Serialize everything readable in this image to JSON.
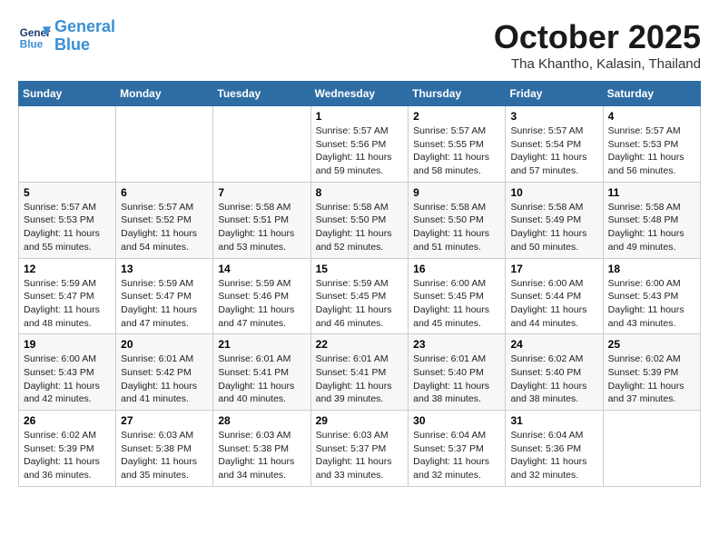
{
  "header": {
    "logo_line1": "General",
    "logo_line2": "Blue",
    "month": "October 2025",
    "location": "Tha Khantho, Kalasin, Thailand"
  },
  "weekdays": [
    "Sunday",
    "Monday",
    "Tuesday",
    "Wednesday",
    "Thursday",
    "Friday",
    "Saturday"
  ],
  "weeks": [
    [
      {
        "day": "",
        "info": ""
      },
      {
        "day": "",
        "info": ""
      },
      {
        "day": "",
        "info": ""
      },
      {
        "day": "1",
        "info": "Sunrise: 5:57 AM\nSunset: 5:56 PM\nDaylight: 11 hours\nand 59 minutes."
      },
      {
        "day": "2",
        "info": "Sunrise: 5:57 AM\nSunset: 5:55 PM\nDaylight: 11 hours\nand 58 minutes."
      },
      {
        "day": "3",
        "info": "Sunrise: 5:57 AM\nSunset: 5:54 PM\nDaylight: 11 hours\nand 57 minutes."
      },
      {
        "day": "4",
        "info": "Sunrise: 5:57 AM\nSunset: 5:53 PM\nDaylight: 11 hours\nand 56 minutes."
      }
    ],
    [
      {
        "day": "5",
        "info": "Sunrise: 5:57 AM\nSunset: 5:53 PM\nDaylight: 11 hours\nand 55 minutes."
      },
      {
        "day": "6",
        "info": "Sunrise: 5:57 AM\nSunset: 5:52 PM\nDaylight: 11 hours\nand 54 minutes."
      },
      {
        "day": "7",
        "info": "Sunrise: 5:58 AM\nSunset: 5:51 PM\nDaylight: 11 hours\nand 53 minutes."
      },
      {
        "day": "8",
        "info": "Sunrise: 5:58 AM\nSunset: 5:50 PM\nDaylight: 11 hours\nand 52 minutes."
      },
      {
        "day": "9",
        "info": "Sunrise: 5:58 AM\nSunset: 5:50 PM\nDaylight: 11 hours\nand 51 minutes."
      },
      {
        "day": "10",
        "info": "Sunrise: 5:58 AM\nSunset: 5:49 PM\nDaylight: 11 hours\nand 50 minutes."
      },
      {
        "day": "11",
        "info": "Sunrise: 5:58 AM\nSunset: 5:48 PM\nDaylight: 11 hours\nand 49 minutes."
      }
    ],
    [
      {
        "day": "12",
        "info": "Sunrise: 5:59 AM\nSunset: 5:47 PM\nDaylight: 11 hours\nand 48 minutes."
      },
      {
        "day": "13",
        "info": "Sunrise: 5:59 AM\nSunset: 5:47 PM\nDaylight: 11 hours\nand 47 minutes."
      },
      {
        "day": "14",
        "info": "Sunrise: 5:59 AM\nSunset: 5:46 PM\nDaylight: 11 hours\nand 47 minutes."
      },
      {
        "day": "15",
        "info": "Sunrise: 5:59 AM\nSunset: 5:45 PM\nDaylight: 11 hours\nand 46 minutes."
      },
      {
        "day": "16",
        "info": "Sunrise: 6:00 AM\nSunset: 5:45 PM\nDaylight: 11 hours\nand 45 minutes."
      },
      {
        "day": "17",
        "info": "Sunrise: 6:00 AM\nSunset: 5:44 PM\nDaylight: 11 hours\nand 44 minutes."
      },
      {
        "day": "18",
        "info": "Sunrise: 6:00 AM\nSunset: 5:43 PM\nDaylight: 11 hours\nand 43 minutes."
      }
    ],
    [
      {
        "day": "19",
        "info": "Sunrise: 6:00 AM\nSunset: 5:43 PM\nDaylight: 11 hours\nand 42 minutes."
      },
      {
        "day": "20",
        "info": "Sunrise: 6:01 AM\nSunset: 5:42 PM\nDaylight: 11 hours\nand 41 minutes."
      },
      {
        "day": "21",
        "info": "Sunrise: 6:01 AM\nSunset: 5:41 PM\nDaylight: 11 hours\nand 40 minutes."
      },
      {
        "day": "22",
        "info": "Sunrise: 6:01 AM\nSunset: 5:41 PM\nDaylight: 11 hours\nand 39 minutes."
      },
      {
        "day": "23",
        "info": "Sunrise: 6:01 AM\nSunset: 5:40 PM\nDaylight: 11 hours\nand 38 minutes."
      },
      {
        "day": "24",
        "info": "Sunrise: 6:02 AM\nSunset: 5:40 PM\nDaylight: 11 hours\nand 38 minutes."
      },
      {
        "day": "25",
        "info": "Sunrise: 6:02 AM\nSunset: 5:39 PM\nDaylight: 11 hours\nand 37 minutes."
      }
    ],
    [
      {
        "day": "26",
        "info": "Sunrise: 6:02 AM\nSunset: 5:39 PM\nDaylight: 11 hours\nand 36 minutes."
      },
      {
        "day": "27",
        "info": "Sunrise: 6:03 AM\nSunset: 5:38 PM\nDaylight: 11 hours\nand 35 minutes."
      },
      {
        "day": "28",
        "info": "Sunrise: 6:03 AM\nSunset: 5:38 PM\nDaylight: 11 hours\nand 34 minutes."
      },
      {
        "day": "29",
        "info": "Sunrise: 6:03 AM\nSunset: 5:37 PM\nDaylight: 11 hours\nand 33 minutes."
      },
      {
        "day": "30",
        "info": "Sunrise: 6:04 AM\nSunset: 5:37 PM\nDaylight: 11 hours\nand 32 minutes."
      },
      {
        "day": "31",
        "info": "Sunrise: 6:04 AM\nSunset: 5:36 PM\nDaylight: 11 hours\nand 32 minutes."
      },
      {
        "day": "",
        "info": ""
      }
    ]
  ]
}
